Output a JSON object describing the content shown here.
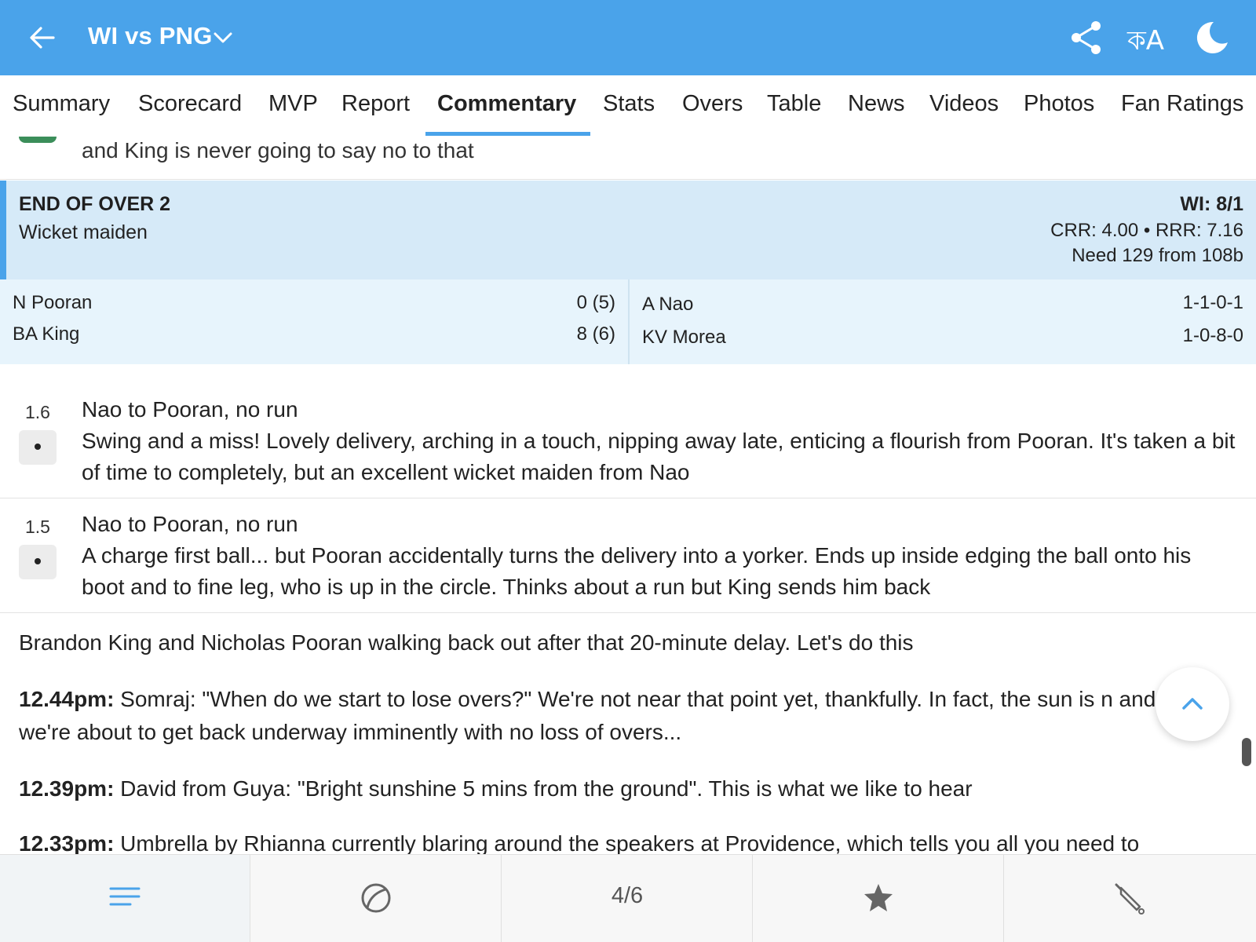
{
  "header": {
    "title": "WI vs PNG",
    "lang_label": "কA"
  },
  "tabs": [
    {
      "label": "Summary"
    },
    {
      "label": "Scorecard"
    },
    {
      "label": "MVP"
    },
    {
      "label": "Report"
    },
    {
      "label": "Commentary",
      "active": true
    },
    {
      "label": "Stats"
    },
    {
      "label": "Overs"
    },
    {
      "label": "Table"
    },
    {
      "label": "News"
    },
    {
      "label": "Videos"
    },
    {
      "label": "Photos"
    },
    {
      "label": "Fan Ratings"
    }
  ],
  "partial_text": "and King is never going to say no to that",
  "over_summary": {
    "heading": "END OF OVER 2",
    "subheading": "Wicket maiden",
    "score": "WI: 8/1",
    "rates": "CRR: 4.00 • RRR: 7.16",
    "need": "Need 129 from 108b"
  },
  "batters": [
    {
      "name": "N Pooran",
      "score": "0 (5)"
    },
    {
      "name": "BA King",
      "score": "8 (6)"
    }
  ],
  "bowlers": [
    {
      "name": "A Nao",
      "figures": "1-1-0-1"
    },
    {
      "name": "KV Morea",
      "figures": "1-0-8-0"
    }
  ],
  "balls": [
    {
      "over": "1.6",
      "headline": "Nao to Pooran, no run",
      "text": "Swing and a miss! Lovely delivery, arching in a touch, nipping away late, enticing a flourish from Pooran. It's taken a bit of time to completely, but an excellent wicket maiden from Nao"
    },
    {
      "over": "1.5",
      "headline": "Nao to Pooran, no run",
      "text": "A charge first ball... but Pooran accidentally turns the delivery into a yorker. Ends up inside edging the ball onto his boot and to fine leg, who is up in the circle. Thinks about a run but King sends him back"
    }
  ],
  "updates": [
    {
      "time": "",
      "text": "Brandon King and Nicholas Pooran walking back out after that 20-minute delay. Let's do this"
    },
    {
      "time": "12.44pm:",
      "text": " Somraj: \"When do we start to lose overs?\" We're not near that point yet, thankfully. In fact, the sun is n and we're about to get back underway imminently with no loss of overs..."
    },
    {
      "time": "12.39pm:",
      "text": " David from Guya: \"Bright sunshine 5 mins from the ground\". This is what we like to hear"
    },
    {
      "time": "12.33pm:",
      "text": " Umbrella by Rhianna currently blaring around the speakers at Providence, which tells you all you need to"
    }
  ],
  "bottom_nav": {
    "page_indicator": "4/6"
  },
  "colors": {
    "accent": "#4aa3ea",
    "over_card_bg": "#d6eaf8",
    "players_bg": "#e7f4fc"
  }
}
